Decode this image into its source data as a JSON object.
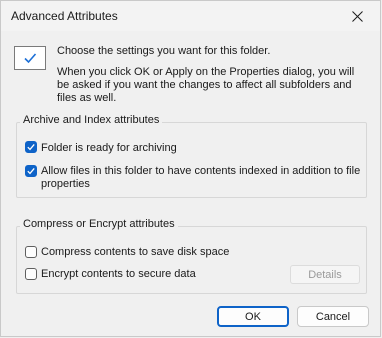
{
  "window": {
    "title": "Advanced Attributes",
    "close_icon": "close-icon"
  },
  "intro": {
    "line1": "Choose the settings you want for this folder.",
    "line2": "When you click OK or Apply on the Properties dialog, you will be asked if you want the changes to affect all subfolders and files as well.",
    "icon": "folder-check-icon"
  },
  "archive_group": {
    "label": "Archive and Index attributes",
    "items": [
      {
        "label": "Folder is ready for archiving",
        "checked": true
      },
      {
        "label": "Allow files in this folder to have contents indexed in addition to file",
        "label_cont": "properties",
        "checked": true
      }
    ]
  },
  "compress_group": {
    "label": "Compress or Encrypt attributes",
    "items": [
      {
        "label": "Compress contents to save disk space",
        "checked": false
      },
      {
        "label": "Encrypt contents to secure data",
        "checked": false
      }
    ],
    "details_label": "Details"
  },
  "buttons": {
    "ok": "OK",
    "cancel": "Cancel"
  },
  "colors": {
    "accent": "#0e63c8",
    "background": "#f0f0f0"
  }
}
